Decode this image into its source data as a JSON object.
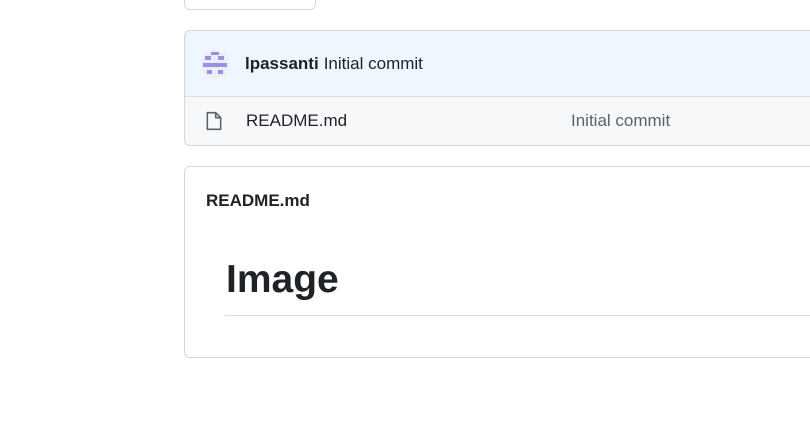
{
  "commit": {
    "author": "lpassanti",
    "message": "Initial commit"
  },
  "files": [
    {
      "name": "README.md",
      "last_commit": "Initial commit",
      "icon": "file-icon"
    }
  ],
  "readme": {
    "title": "README.md",
    "heading": "Image"
  },
  "colors": {
    "commit_bg": "#eef6ff",
    "file_row_bg": "#f6f8fa",
    "border": "#d0d7de",
    "avatar_accent": "#9b8fe0"
  }
}
